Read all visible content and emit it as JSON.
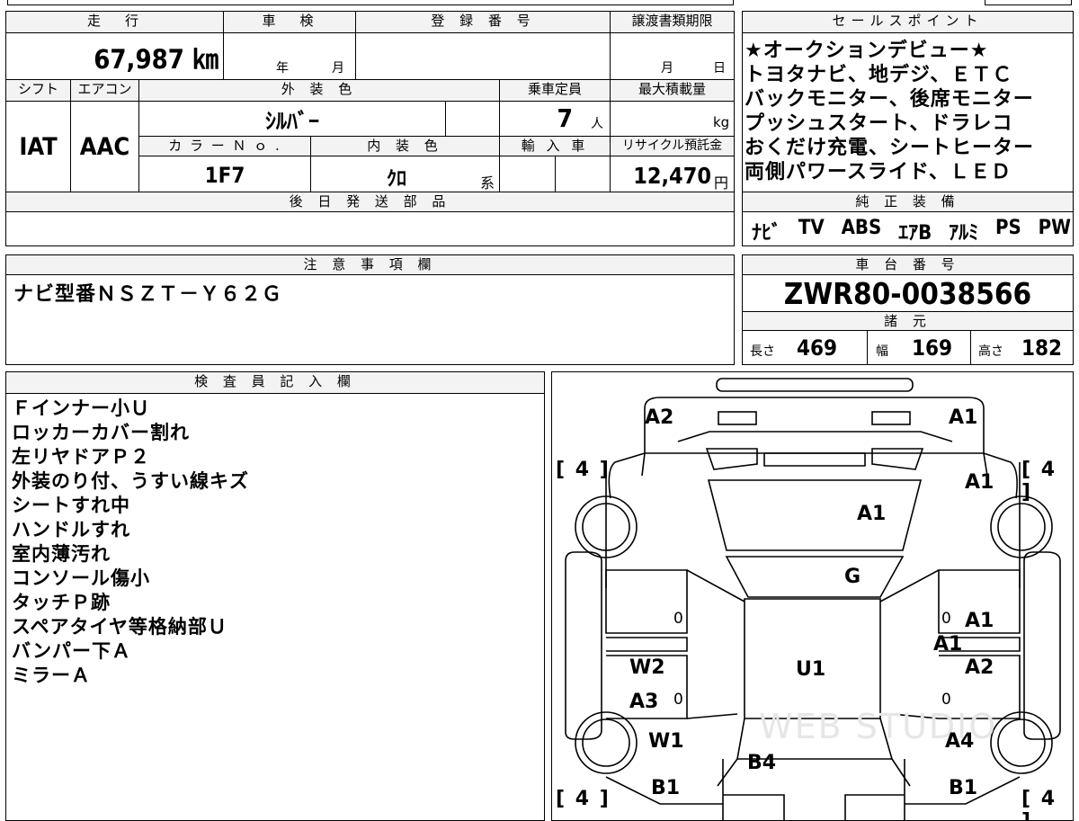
{
  "header_row": {
    "mileage_label": "走　行",
    "inspection_label": "車　検",
    "registration_label": "登 録 番 号",
    "transfer_deadline_label": "譲渡書類期限",
    "mileage_value": "67,987 ㎞",
    "inspection_year": "年",
    "inspection_month": "月",
    "transfer_month": "月",
    "transfer_day": "日"
  },
  "spec_row": {
    "shift_label": "シフト",
    "ac_label": "エアコン",
    "exterior_color_label": "外 装 色",
    "capacity_label": "乗車定員",
    "max_load_label": "最大積載量",
    "shift_value": "IAT",
    "ac_value": "AAC",
    "exterior_color_value": "ｼﾙﾊﾞｰ",
    "capacity_value": "7",
    "capacity_unit": "人",
    "max_load_unit": "kg",
    "color_no_label": "カ ラ ー Ｎ ｏ .",
    "interior_color_label": "内 装 色",
    "import_label": "輸 入 車",
    "recycle_label": "リサイクル預託金",
    "color_no_value": "1F7",
    "interior_color_value": "ｸﾛ",
    "interior_color_suffix": "系",
    "recycle_value": "12,470",
    "recycle_unit": "円"
  },
  "later_parts": {
    "label": "後 日 発 送 部 品",
    "value": ""
  },
  "sales_points": {
    "label": "セールスポイント",
    "lines": [
      "★オークションデビュー★",
      "トヨタナビ、地デジ、ＥＴＣ",
      "バックモニター、後席モニター",
      "プッシュスタート、ドラレコ",
      "おくだけ充電、シートヒーター",
      "両側パワースライド、ＬＥＤ"
    ]
  },
  "genuine_equipment": {
    "label": "純 正 装 備",
    "items": [
      "ﾅﾋﾞ",
      "TV",
      "ABS",
      "ｴｱB",
      "ｱﾙﾐ",
      "PS",
      "PW"
    ]
  },
  "notes": {
    "label": "注 意 事 項 欄",
    "text": "ナビ型番ＮＳＺＴ－Ｙ６２Ｇ"
  },
  "chassis": {
    "label": "車 台 番 号",
    "value": "ZWR80-0038566",
    "specs_label": "諸 元",
    "length_label": "長さ",
    "length_value": "469",
    "width_label": "幅",
    "width_value": "169",
    "height_label": "高さ",
    "height_value": "182"
  },
  "inspector": {
    "label": "検 査 員 記 入 欄",
    "lines": [
      "Ｆインナー小Ｕ",
      "ロッカーカバー割れ",
      "左リヤドアＰ２",
      "外装のり付、うすい線キズ",
      "シートすれ中",
      "ハンドルすれ",
      "室内薄汚れ",
      "コンソール傷小",
      "タッチＰ跡",
      "スペアタイヤ等格納部Ｕ",
      "バンパー下Ａ",
      "ミラーＡ"
    ]
  },
  "diagram": {
    "marks": {
      "front_left": "A2",
      "front_right": "A1",
      "fender_right": "A1",
      "hood": "A1",
      "glass": "G",
      "right_front_door": "A1",
      "right_pillar": "A1",
      "right_rear_door": "A2",
      "left_rear_door": "W2",
      "left_rear_lower": "A3",
      "left_rear_fender": "W1",
      "roof": "U1",
      "rear_right": "A4",
      "back_door": "B4",
      "rear_bumper_left": "B1",
      "rear_bumper_right": "B1"
    },
    "tire_front_left": "4",
    "tire_front_right": "4",
    "tire_rear_left": "4",
    "tire_rear_right": "4",
    "zero": "0",
    "watermark": "WEB STUDIO"
  }
}
